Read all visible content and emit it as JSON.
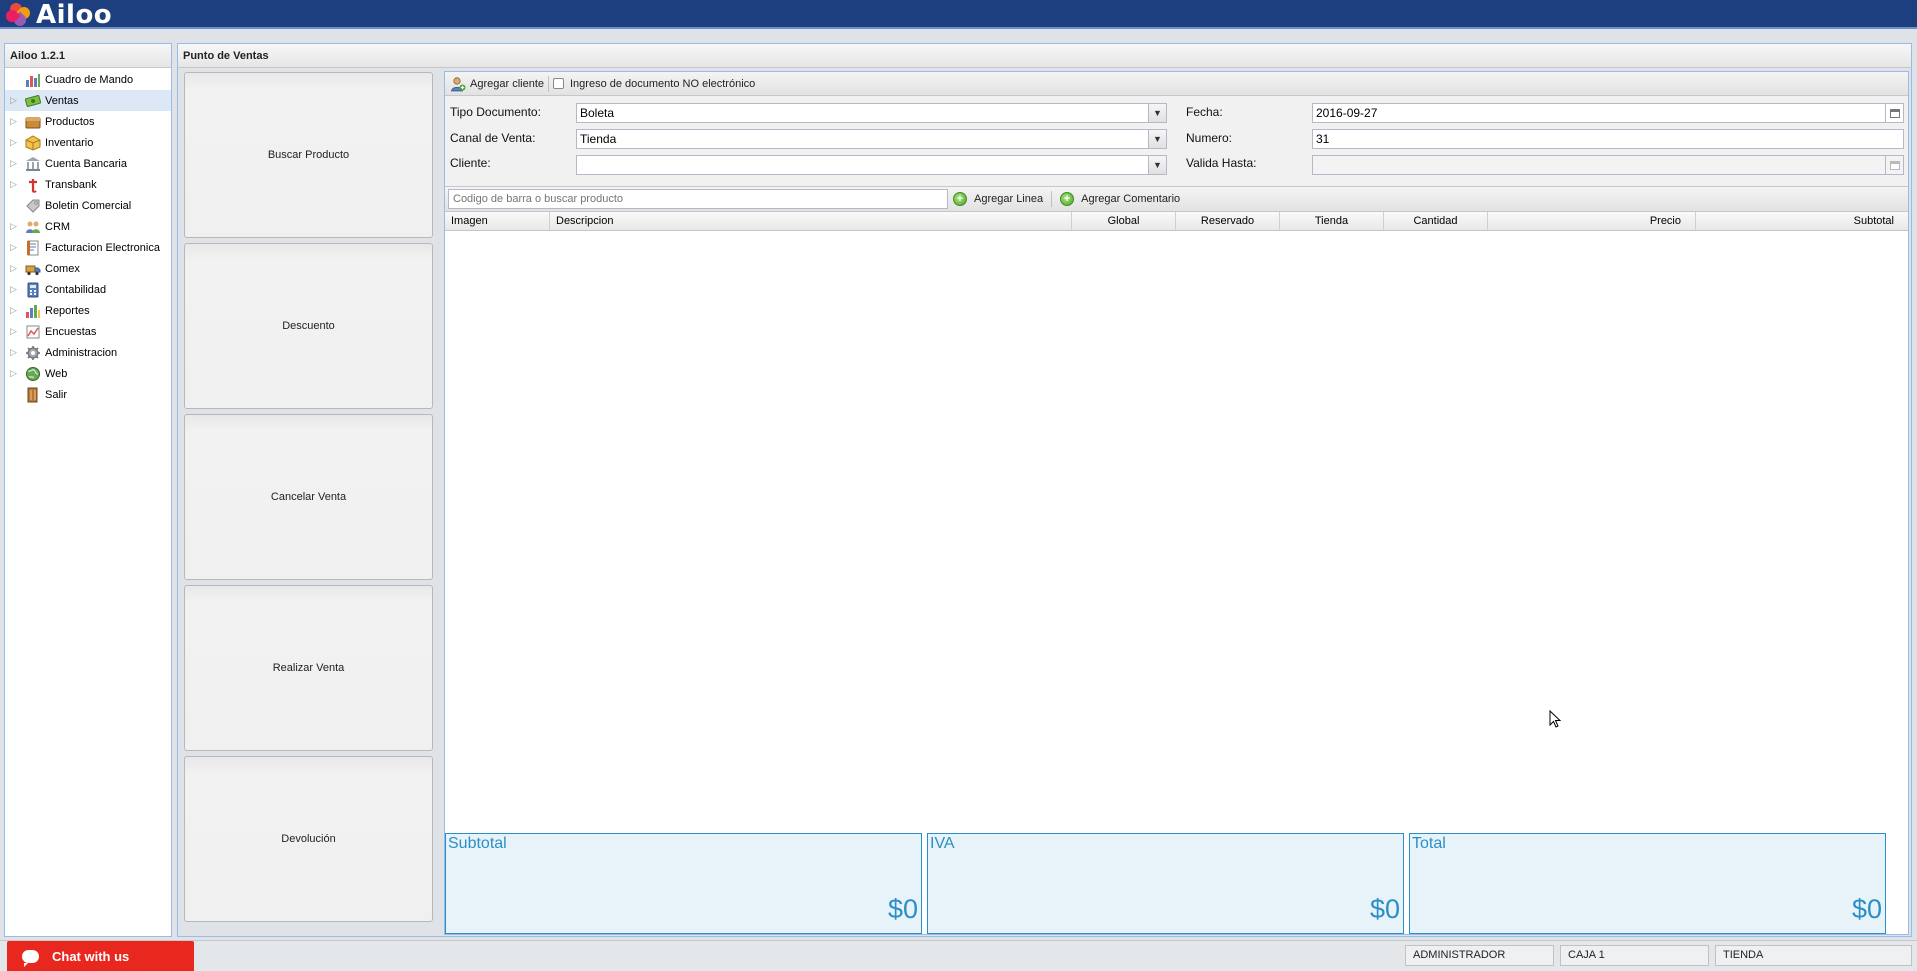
{
  "app": {
    "logo_text": "Ailoo"
  },
  "sidebar": {
    "title": "Ailoo 1.2.1",
    "items": [
      {
        "label": "Cuadro de Mando",
        "icon": "chart-icon",
        "expandable": false,
        "selected": false
      },
      {
        "label": "Ventas",
        "icon": "money-icon",
        "expandable": true,
        "selected": true
      },
      {
        "label": "Productos",
        "icon": "box-icon",
        "expandable": true,
        "selected": false
      },
      {
        "label": "Inventario",
        "icon": "package-icon",
        "expandable": true,
        "selected": false
      },
      {
        "label": "Cuenta Bancaria",
        "icon": "bank-icon",
        "expandable": true,
        "selected": false
      },
      {
        "label": "Transbank",
        "icon": "transbank-icon",
        "expandable": true,
        "selected": false
      },
      {
        "label": "Boletin Comercial",
        "icon": "tag-icon",
        "expandable": false,
        "selected": false
      },
      {
        "label": "CRM",
        "icon": "users-icon",
        "expandable": true,
        "selected": false
      },
      {
        "label": "Facturacion Electronica",
        "icon": "invoice-icon",
        "expandable": true,
        "selected": false
      },
      {
        "label": "Comex",
        "icon": "truck-icon",
        "expandable": true,
        "selected": false
      },
      {
        "label": "Contabilidad",
        "icon": "calculator-icon",
        "expandable": true,
        "selected": false
      },
      {
        "label": "Reportes",
        "icon": "report-chart-icon",
        "expandable": true,
        "selected": false
      },
      {
        "label": "Encuestas",
        "icon": "survey-icon",
        "expandable": true,
        "selected": false
      },
      {
        "label": "Administracion",
        "icon": "gear-icon",
        "expandable": true,
        "selected": false
      },
      {
        "label": "Web",
        "icon": "globe-icon",
        "expandable": true,
        "selected": false
      },
      {
        "label": "Salir",
        "icon": "exit-door-icon",
        "expandable": false,
        "selected": false
      }
    ]
  },
  "main": {
    "title": "Punto de Ventas",
    "actions": {
      "buscar": "Buscar Producto",
      "descuento": "Descuento",
      "cancelar": "Cancelar Venta",
      "realizar": "Realizar Venta",
      "devolucion": "Devolución"
    },
    "toolbar": {
      "add_client": "Agregar cliente",
      "non_electronic": "Ingreso de documento NO electrónico"
    },
    "form": {
      "tipo_label": "Tipo Documento:",
      "tipo_value": "Boleta",
      "canal_label": "Canal de Venta:",
      "canal_value": "Tienda",
      "cliente_label": "Cliente:",
      "cliente_value": "",
      "fecha_label": "Fecha:",
      "fecha_value": "2016-09-27",
      "numero_label": "Numero:",
      "numero_value": "31",
      "valida_label": "Valida Hasta:",
      "valida_value": ""
    },
    "search": {
      "placeholder": "Codigo de barra o buscar producto",
      "add_line": "Agregar Linea",
      "add_comment": "Agregar Comentario"
    },
    "grid": {
      "columns": {
        "imagen": "Imagen",
        "descripcion": "Descripcion",
        "global": "Global",
        "reservado": "Reservado",
        "tienda": "Tienda",
        "cantidad": "Cantidad",
        "precio": "Precio",
        "subtotal": "Subtotal"
      },
      "rows": []
    },
    "totals": {
      "subtotal_label": "Subtotal",
      "subtotal_value": "$0",
      "iva_label": "IVA",
      "iva_value": "$0",
      "total_label": "Total",
      "total_value": "$0"
    }
  },
  "statusbar": {
    "chat": "Chat with us",
    "user": "ADMINISTRADOR",
    "register": "CAJA 1",
    "store": "TIENDA"
  },
  "colors": {
    "topbar": "#1d3f7f",
    "accent_blue": "#2b8fc7",
    "chat_red": "#e8281f",
    "selected_row": "#dde8f7"
  }
}
